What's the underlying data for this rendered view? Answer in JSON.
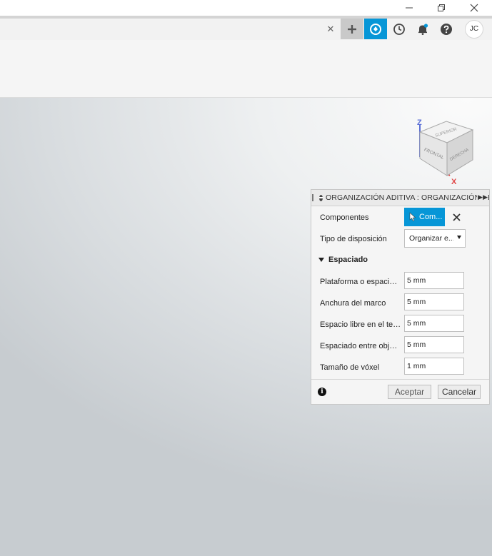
{
  "titlebar": {
    "minimize": "—",
    "restore": "❐",
    "close": "✕"
  },
  "toolbar": {
    "tab_close": "✕",
    "user_initials": "JC"
  },
  "dialog": {
    "title": "ORGANIZACIÓN ADITIVA : ORGANIZACIÓN DE",
    "components_label": "Componentes",
    "components_button": "Com...",
    "layout_type_label": "Tipo de disposición",
    "layout_type_value": "Organizar e...",
    "spacing_section": "Espaciado",
    "rows": [
      {
        "label": "Plataforma o espacio ...",
        "value": "5 mm"
      },
      {
        "label": "Anchura del marco",
        "value": "5 mm"
      },
      {
        "label": "Espacio libre en el tec...",
        "value": "5 mm"
      },
      {
        "label": "Espaciado entre objet...",
        "value": "5 mm"
      },
      {
        "label": "Tamaño de vóxel",
        "value": "1 mm"
      }
    ],
    "ok_button": "Aceptar",
    "cancel_button": "Cancelar"
  },
  "viewcube": {
    "z_axis": "Z",
    "x_axis": "X",
    "face_top": "SUPERIOR",
    "face_front": "FRONTAL",
    "face_right": "DERECHA"
  },
  "colors": {
    "accent": "#0696d7",
    "axis_z": "#5b6fd6",
    "axis_x": "#e04848"
  }
}
